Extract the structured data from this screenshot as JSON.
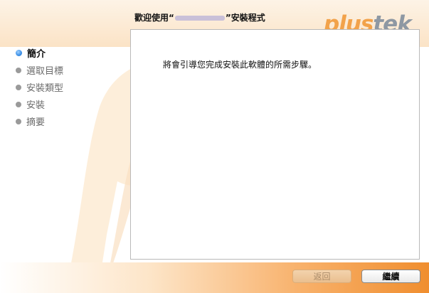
{
  "window": {
    "title_prefix": "歡迎使用“",
    "title_suffix": "”安裝程式",
    "logo_part1": "plus",
    "logo_part2": "tek"
  },
  "sidebar": {
    "steps": [
      {
        "label": "簡介",
        "current": true
      },
      {
        "label": "選取目標",
        "current": false
      },
      {
        "label": "安裝類型",
        "current": false
      },
      {
        "label": "安裝",
        "current": false
      },
      {
        "label": "摘要",
        "current": false
      }
    ]
  },
  "content": {
    "message": "將會引導您完成安裝此軟體的所需步驟。"
  },
  "footer": {
    "back_label": "返回",
    "continue_label": "繼續"
  },
  "colors": {
    "accent_orange": "#f08e2f",
    "logo_tek": "#8e98a3",
    "current_step_dot": "#3b8fe6"
  }
}
